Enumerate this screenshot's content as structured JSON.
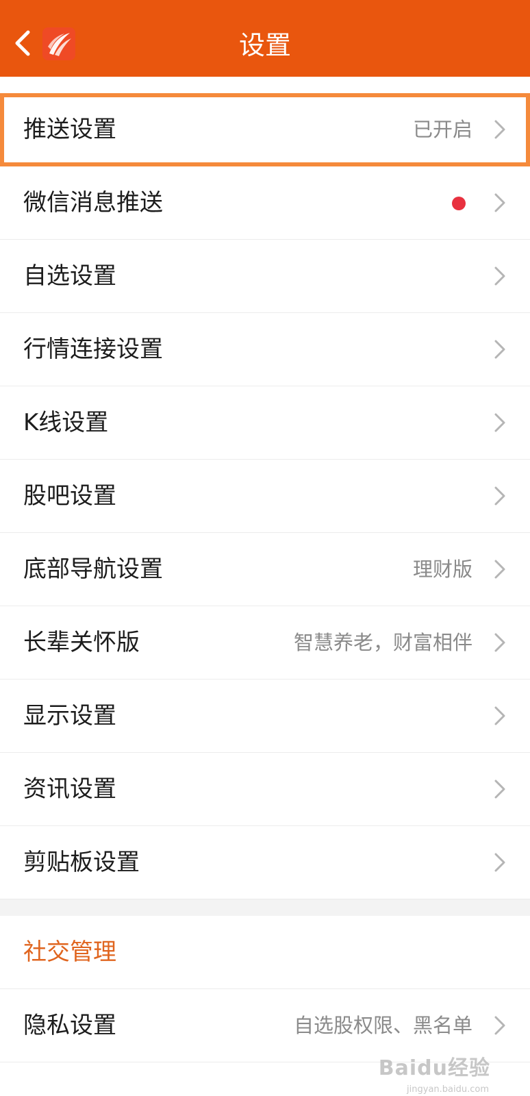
{
  "header": {
    "title": "设置",
    "back_icon": "chevron-left-icon",
    "logo_icon": "app-logo-icon",
    "background_color": "#e9560e"
  },
  "settings": [
    {
      "label": "推送设置",
      "value": "已开启",
      "highlighted": true
    },
    {
      "label": "微信消息推送",
      "value": "",
      "badge": "red-dot"
    },
    {
      "label": "自选设置",
      "value": ""
    },
    {
      "label": "行情连接设置",
      "value": ""
    },
    {
      "label": "K线设置",
      "value": ""
    },
    {
      "label": "股吧设置",
      "value": ""
    },
    {
      "label": "底部导航设置",
      "value": "理财版"
    },
    {
      "label": "长辈关怀版",
      "value": "智慧养老，财富相伴"
    },
    {
      "label": "显示设置",
      "value": ""
    },
    {
      "label": "资讯设置",
      "value": ""
    },
    {
      "label": "剪贴板设置",
      "value": ""
    }
  ],
  "social": {
    "header": "社交管理",
    "items": [
      {
        "label": "隐私设置",
        "value": "自选股权限、黑名单"
      }
    ]
  },
  "watermark": {
    "text": "Baidu经验",
    "sub": "jingyan.baidu.com"
  },
  "colors": {
    "accent": "#e9560e",
    "highlight_border": "#f58a3b",
    "section_header": "#e0651f",
    "red_dot": "#e8313f"
  }
}
